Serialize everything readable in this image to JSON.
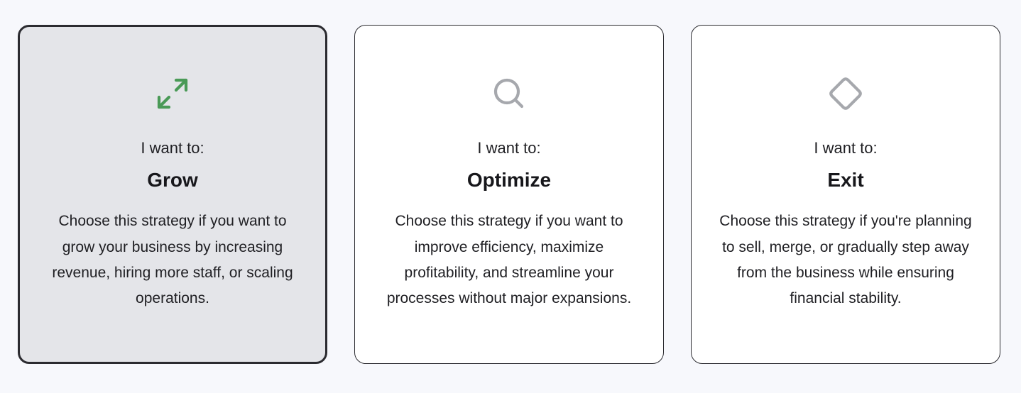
{
  "colors": {
    "page_background": "#f7f8fc",
    "card_background": "#ffffff",
    "card_selected_background": "#e4e5e9",
    "card_border": "#2b2b30",
    "icon_active": "#4a9a57",
    "icon_inactive": "#a6a8ad"
  },
  "cards": [
    {
      "icon": "expand-arrows-icon",
      "prompt": "I want to:",
      "title": "Grow",
      "description": "Choose this strategy if you want to grow your business by increasing revenue, hiring more staff, or scaling operations.",
      "selected": true
    },
    {
      "icon": "magnifier-icon",
      "prompt": "I want to:",
      "title": "Optimize",
      "description": "Choose this strategy if you want to improve efficiency, maximize profitability, and streamline your processes without major expansions.",
      "selected": false
    },
    {
      "icon": "diamond-icon",
      "prompt": "I want to:",
      "title": "Exit",
      "description": "Choose this strategy if you're planning to sell, merge, or gradually step away from the business while ensuring financial stability.",
      "selected": false
    }
  ]
}
